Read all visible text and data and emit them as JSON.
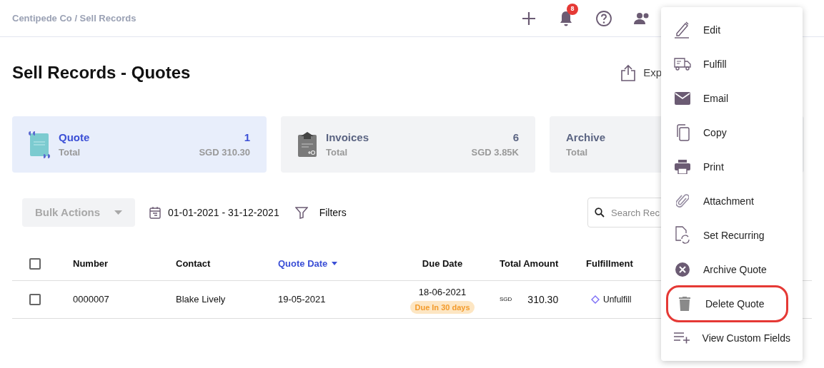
{
  "breadcrumb": "Centipede Co / Sell Records",
  "notification_count": "8",
  "title": "Sell Records - Quotes",
  "export_label": "Exp",
  "cards": [
    {
      "kind": "quote",
      "label": "Quote",
      "sub": "Total",
      "count": "1",
      "amount": "SGD 310.30",
      "selected": true
    },
    {
      "kind": "invoice",
      "label": "Invoices",
      "sub": "Total",
      "count": "6",
      "amount": "SGD 3.85K",
      "selected": false
    },
    {
      "kind": "archive",
      "label": "Archive",
      "sub": "Total",
      "selected": false
    }
  ],
  "toolbar": {
    "bulk_actions": {
      "label": "Bulk Actions",
      "disabled": true
    },
    "date_range": "01-01-2021 - 31-12-2021",
    "filters": "Filters",
    "search": {
      "placeholder": "Search Rec"
    }
  },
  "table": {
    "columns": [
      {
        "label": "Number",
        "sorted": false
      },
      {
        "label": "Contact",
        "sorted": false
      },
      {
        "label": "Quote Date",
        "sorted": true
      },
      {
        "label": "Due Date",
        "sorted": false
      },
      {
        "label": "Total Amount",
        "sorted": false
      },
      {
        "label": "Fulfillment",
        "sorted": false
      }
    ],
    "rows": [
      {
        "checked": false,
        "number": "0000007",
        "contact": "Blake Lively",
        "quote_date": "19-05-2021",
        "due_date": "18-06-2021",
        "due_badge": "Due In 30 days",
        "currency": "SGD",
        "amount": "310.30",
        "fulfillment": "Unfulfill"
      }
    ]
  },
  "header_checked": false,
  "menu": [
    {
      "kind": "edit",
      "label": "Edit",
      "circled": false
    },
    {
      "kind": "truck",
      "label": "Fulfill",
      "circled": false
    },
    {
      "kind": "mail",
      "label": "Email",
      "circled": false
    },
    {
      "kind": "copy",
      "label": "Copy",
      "circled": false
    },
    {
      "kind": "print",
      "label": "Print",
      "circled": false
    },
    {
      "kind": "clip",
      "label": "Attachment",
      "circled": false
    },
    {
      "kind": "recurring",
      "label": "Set Recurring",
      "circled": false
    },
    {
      "kind": "archive",
      "label": "Archive Quote",
      "circled": false
    },
    {
      "kind": "trash",
      "label": "Delete Quote",
      "circled": true
    },
    {
      "kind": "fields",
      "label": "View Custom Fields",
      "circled": false
    }
  ]
}
